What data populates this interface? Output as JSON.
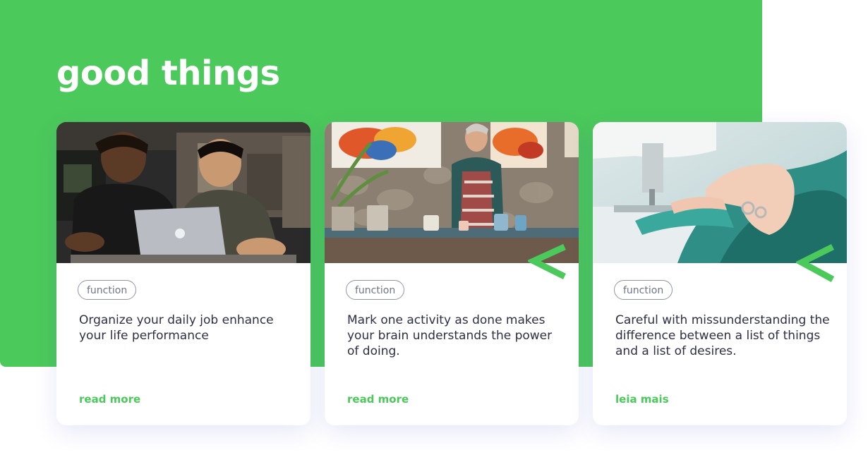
{
  "section": {
    "title": "good things"
  },
  "colors": {
    "accent": "#4bc95a",
    "text": "#2c2f45",
    "tag_border": "#8e95a8"
  },
  "cards": [
    {
      "image": "two-people-laughing-at-laptop-photo",
      "tag": "function",
      "text": "Organize your daily job enhance your life performance",
      "link": "read more"
    },
    {
      "image": "painter-in-art-studio-photo",
      "tag": "function",
      "text": "Mark one activity as done makes your brain understands the power of doing.",
      "link": "read more"
    },
    {
      "image": "hands-sewing-teal-fabric-photo",
      "tag": "function",
      "text": "Careful with missunderstanding the difference between a list of things and a list of desires.",
      "link": "leia mais"
    }
  ]
}
